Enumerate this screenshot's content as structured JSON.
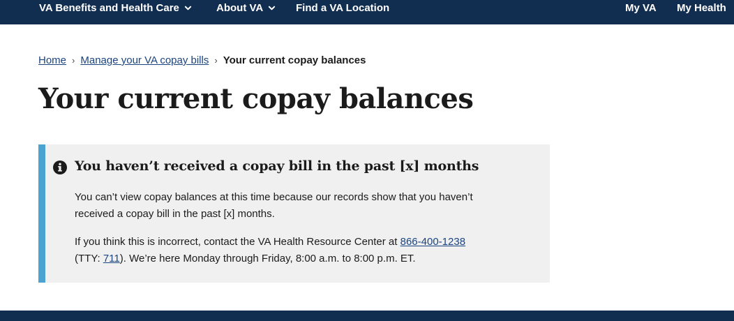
{
  "nav": {
    "benefits": "VA Benefits and Health Care",
    "about": "About VA",
    "find": "Find a VA Location",
    "myva": "My VA",
    "myhealth": "My Health"
  },
  "breadcrumb": {
    "home": "Home",
    "manage": "Manage your VA copay bills",
    "current": "Your current copay balances",
    "separator": "›"
  },
  "page": {
    "title": "Your current copay balances"
  },
  "alert": {
    "heading": "You haven’t received a copay bill in the past [x] months",
    "paragraph1": "You can’t view copay balances at this time because our records show that you haven’t received a copay bill in the past [x] months.",
    "paragraph2_prefix": "If you think this is incorrect, contact the VA Health Resource Center at ",
    "phone": "866-400-1238",
    "tty_open": " (TTY: ",
    "tty": "711",
    "paragraph2_suffix": "). We’re here Monday through Friday, 8:00 a.m. to 8:00 p.m. ET.",
    "icon": "info-circle-icon"
  },
  "colors": {
    "nav_bg": "#112e51",
    "alert_bar": "#4aa3d1",
    "alert_bg": "#f0f0f0",
    "link": "#1a4480"
  }
}
